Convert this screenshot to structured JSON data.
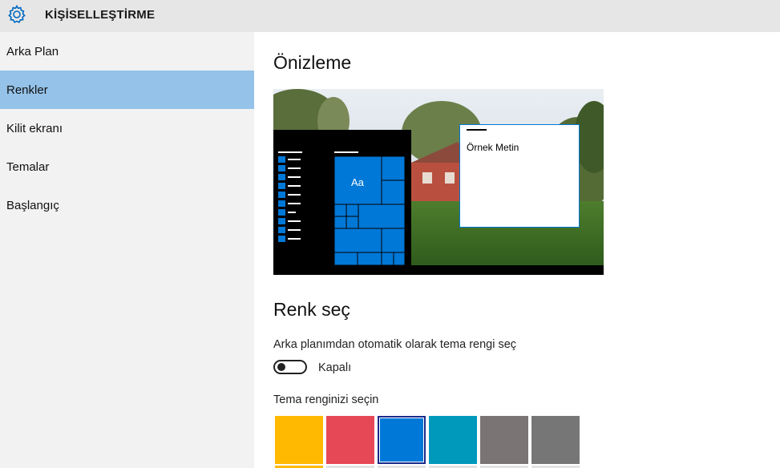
{
  "header": {
    "title": "KİŞİSELLEŞTİRME",
    "icon": "gear-icon"
  },
  "sidebar": {
    "items": [
      {
        "label": "Arka Plan",
        "selected": false
      },
      {
        "label": "Renkler",
        "selected": true
      },
      {
        "label": "Kilit ekranı",
        "selected": false
      },
      {
        "label": "Temalar",
        "selected": false
      },
      {
        "label": "Başlangıç",
        "selected": false
      }
    ]
  },
  "main": {
    "preview_heading": "Önizleme",
    "preview": {
      "sample_text": "Örnek Metin",
      "tile_label": "Aa"
    },
    "color_heading": "Renk seç",
    "auto_color_label": "Arka planımdan otomatik olarak tema rengi seç",
    "toggle": {
      "state": "Kapalı",
      "on": false
    },
    "theme_color_label": "Tema renginizi seçin",
    "swatches": [
      "#ffb900",
      "#e74856",
      "#0078d7",
      "#0099bc",
      "#7a7574",
      "#767676"
    ],
    "selected_swatch": 2
  },
  "colors": {
    "accent": "#0078d7",
    "sidebar_selected": "#94c2e8",
    "titlebar": "#e6e6e6",
    "sidebar_bg": "#f2f2f2"
  }
}
